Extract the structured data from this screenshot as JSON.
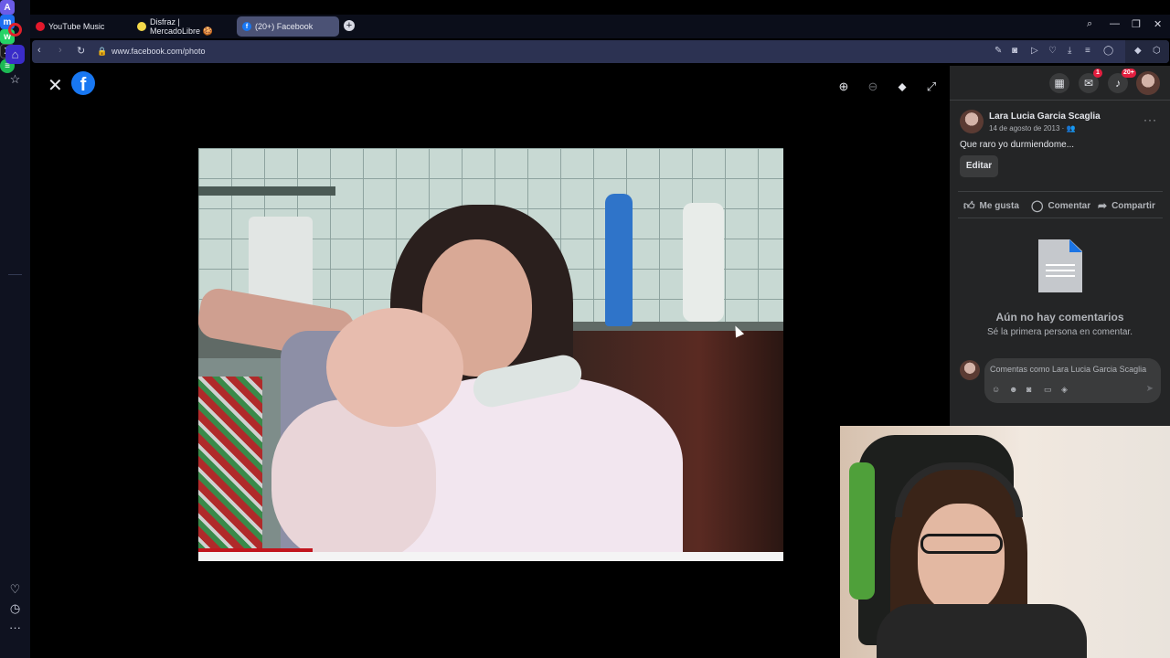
{
  "browser": {
    "tabs": [
      {
        "label": "YouTube Music",
        "fav_color": "#e3182b",
        "active": false
      },
      {
        "label": "Disfraz | MercadoLibre 🍪",
        "fav_color": "#f5d94a",
        "active": false
      },
      {
        "label": "(20+) Facebook",
        "fav_color": "#1877f2",
        "active": true
      }
    ],
    "new_tab_label": "+",
    "url": "www.facebook.com/photo"
  },
  "viewer": {
    "close_label": "✕",
    "logo_letter": "f"
  },
  "panel": {
    "badges": {
      "messenger": "1",
      "notifications": "20+"
    },
    "post": {
      "author": "Lara Lucia Garcia Scaglia",
      "date": "14 de agosto de 2013 · ",
      "caption": "Que raro yo durmiendome...",
      "more_label": "···",
      "edit_label": "Editar"
    },
    "actions": {
      "like": "Me gusta",
      "comment": "Comentar",
      "share": "Compartir"
    },
    "empty": {
      "title": "Aún no hay comentarios",
      "subtitle": "Sé la primera persona en comentar."
    },
    "comment_input": {
      "placeholder": "Comentas como Lara Lucia Garcia Scaglia"
    }
  },
  "colors": {
    "facebook_blue": "#1877f2",
    "panel_bg": "#242526",
    "opera_red": "#e0202b",
    "notification_red": "#e41e3f"
  }
}
